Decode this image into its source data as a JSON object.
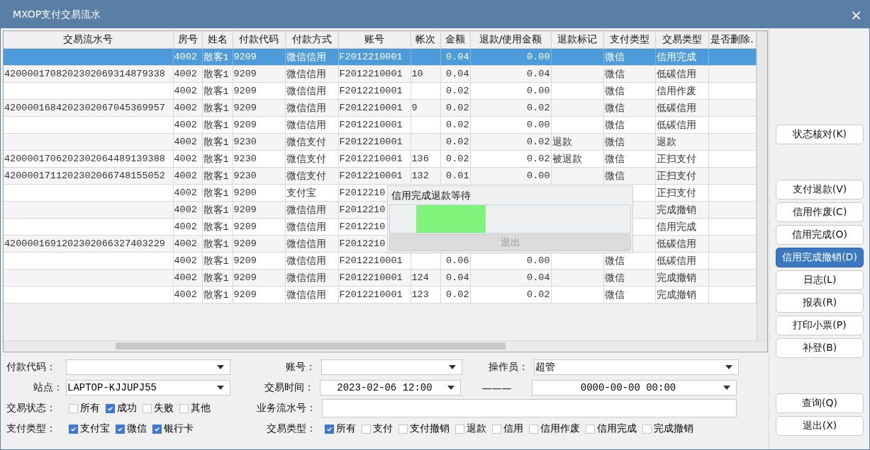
{
  "window": {
    "title": "MXOP支付交易流水",
    "close": "×"
  },
  "table": {
    "columns": [
      "交易流水号",
      "房号",
      "姓名",
      "付款代码",
      "付款方式",
      "账号",
      "帐次",
      "金额",
      "退款/使用金额",
      "退款标记",
      "支付类型",
      "交易类型",
      "是否删除."
    ],
    "rows": [
      {
        "selected": true,
        "cells": [
          null,
          "4002",
          "散客1",
          "9209",
          "微信信用",
          "F2012210001",
          null,
          "0.04",
          "0.00",
          null,
          "微信",
          "信用完成",
          null
        ]
      },
      {
        "selected": false,
        "cells": [
          "4200001708202302069314879338",
          "4002",
          "散客1",
          "9209",
          "微信信用",
          "F2012210001",
          "10",
          "0.04",
          "0.04",
          null,
          "微信",
          "低碳信用",
          null
        ]
      },
      {
        "selected": false,
        "cells": [
          null,
          "4002",
          "散客1",
          "9209",
          "微信信用",
          "F2012210001",
          null,
          "0.02",
          "0.00",
          null,
          "微信",
          "信用作废",
          null
        ]
      },
      {
        "selected": false,
        "cells": [
          "4200001684202302067045369957",
          "4002",
          "散客1",
          "9209",
          "微信信用",
          "F2012210001",
          "9",
          "0.02",
          "0.02",
          null,
          "微信",
          "低碳信用",
          null
        ]
      },
      {
        "selected": false,
        "cells": [
          null,
          "4002",
          "散客1",
          "9209",
          "微信信用",
          "F2012210001",
          null,
          "0.02",
          "0.00",
          null,
          "微信",
          "低碳信用",
          null
        ]
      },
      {
        "selected": false,
        "cells": [
          null,
          "4002",
          "散客1",
          "9230",
          "微信支付",
          "F2012210001",
          null,
          "0.02",
          "0.02",
          "退款",
          "微信",
          "退款",
          null
        ]
      },
      {
        "selected": false,
        "cells": [
          "4200001706202302064489139388",
          "4002",
          "散客1",
          "9230",
          "微信支付",
          "F2012210001",
          "136",
          "0.02",
          "0.02",
          "被退款",
          "微信",
          "正扫支付",
          null
        ]
      },
      {
        "selected": false,
        "cells": [
          "4200001711202302066748155052",
          "4002",
          "散客1",
          "9230",
          "微信支付",
          "F2012210001",
          "132",
          "0.01",
          "0.00",
          null,
          "微信",
          "正扫支付",
          null
        ]
      },
      {
        "selected": false,
        "cells": [
          null,
          "4002",
          "散客1",
          "9200",
          "支付宝",
          "F2012210",
          null,
          null,
          null,
          null,
          null,
          "正扫支付",
          null
        ]
      },
      {
        "selected": false,
        "cells": [
          null,
          "4002",
          "散客1",
          "9209",
          "微信信用",
          "F2012210",
          null,
          null,
          null,
          null,
          null,
          "完成撤销",
          null
        ]
      },
      {
        "selected": false,
        "cells": [
          null,
          "4002",
          "散客1",
          "9209",
          "微信信用",
          "F2012210",
          null,
          null,
          null,
          null,
          null,
          "信用完成",
          null
        ]
      },
      {
        "selected": false,
        "cells": [
          "4200001691202302066327403229",
          "4002",
          "散客1",
          "9209",
          "微信信用",
          "F2012210",
          null,
          null,
          null,
          null,
          null,
          "低碳信用",
          null
        ]
      },
      {
        "selected": false,
        "cells": [
          null,
          "4002",
          "散客1",
          "9209",
          "微信信用",
          "F2012210001",
          null,
          "0.06",
          "0.00",
          null,
          "微信",
          "低碳信用",
          null
        ]
      },
      {
        "selected": false,
        "cells": [
          null,
          "4002",
          "散客1",
          "9209",
          "微信信用",
          "F2012210001",
          "124",
          "0.04",
          "0.04",
          null,
          "微信",
          "完成撤销",
          null
        ]
      },
      {
        "selected": false,
        "cells": [
          null,
          "4002",
          "散客1",
          "9209",
          "微信信用",
          "F2012210001",
          "123",
          "0.02",
          "0.02",
          null,
          "微信",
          "完成撤销",
          null
        ]
      }
    ]
  },
  "dialog": {
    "title": "信用完成退款等待",
    "progress": {
      "level": 0.29
    },
    "button": {
      "label": "退出",
      "disabled": true
    }
  },
  "filters": [
    [
      {
        "kind": "combo",
        "label": "付款代码："
      },
      {
        "kind": "combo",
        "label": "账号："
      },
      {
        "kind": "combo",
        "label": "操作员：",
        "value": "超管"
      }
    ],
    [
      {
        "kind": "combo",
        "label": "站点：",
        "value": "LAPTOP-KJJUPJ55"
      },
      {
        "kind": "date_range",
        "label": "交易时间：",
        "from": "2023-02-06 12:00",
        "separator": "———",
        "to": "0000-00-00 00:00"
      }
    ],
    [
      {
        "kind": "checks",
        "label": "交易状态：",
        "options": [
          {
            "label": "所有",
            "checked": false
          },
          {
            "label": "成功",
            "checked": true
          },
          {
            "label": "失败",
            "checked": false
          },
          {
            "label": "其他",
            "checked": false
          }
        ]
      },
      {
        "kind": "input",
        "label": "业务流水号："
      }
    ],
    [
      {
        "kind": "checks",
        "label": "支付类型：",
        "options": [
          {
            "label": "支付宝",
            "checked": true
          },
          {
            "label": "微信",
            "checked": true
          },
          {
            "label": "银行卡",
            "checked": true
          }
        ]
      },
      {
        "kind": "checks",
        "label": "交易类型：",
        "options": [
          {
            "label": "所有",
            "checked": true
          },
          {
            "label": "支付",
            "checked": false
          },
          {
            "label": "支付撤销",
            "checked": false
          },
          {
            "label": "退款",
            "checked": false
          },
          {
            "label": "信用",
            "checked": false
          },
          {
            "label": "信用作废",
            "checked": false
          },
          {
            "label": "信用完成",
            "checked": false
          },
          {
            "label": "完成撤销",
            "checked": false
          }
        ]
      }
    ]
  ],
  "side_button_groups": [
    [
      {
        "label": "状态核对(K)",
        "focused": false
      }
    ],
    [
      {
        "label": "支付退款(V)",
        "focused": false
      },
      {
        "label": "信用作废(C)",
        "focused": false
      },
      {
        "label": "信用完成(O)",
        "focused": false
      },
      {
        "label": "信用完成撤销(D)",
        "focused": true
      },
      {
        "label": "日志(L)",
        "focused": false
      },
      {
        "label": "报表(R)",
        "focused": false
      },
      {
        "label": "打印小票(P)",
        "focused": false
      },
      {
        "label": "补登(B)",
        "focused": false
      }
    ],
    [
      {
        "label": "查询(Q)",
        "focused": false
      },
      {
        "label": "退出(X)",
        "focused": false
      }
    ]
  ]
}
